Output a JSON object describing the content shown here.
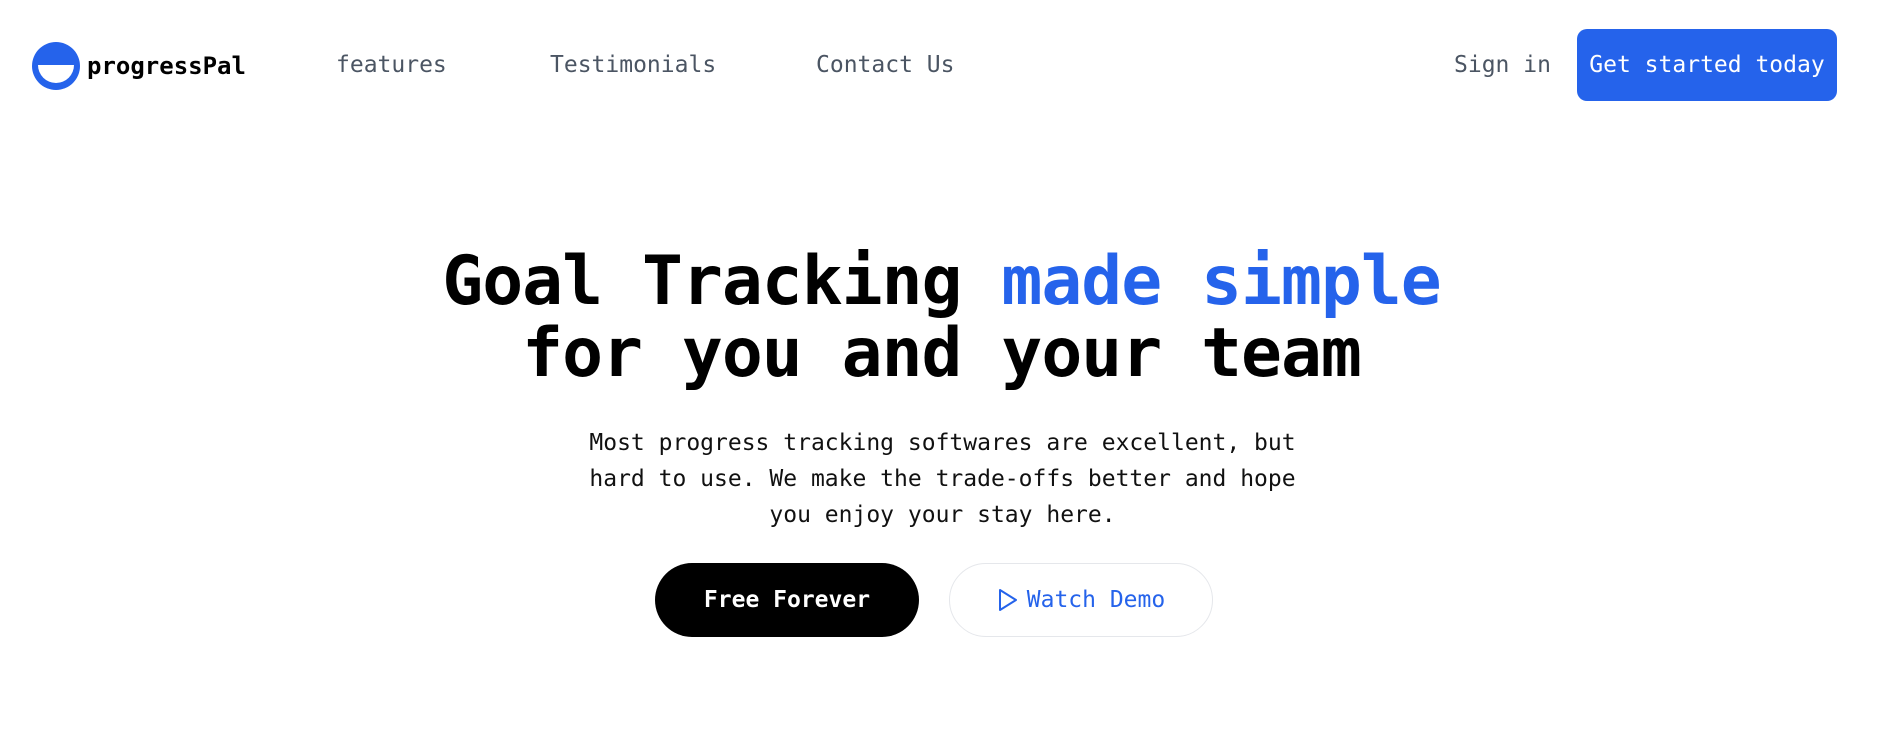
{
  "brand": {
    "name": "progressPal",
    "color": "#2563eb",
    "icon": "smile-circle-icon"
  },
  "nav": {
    "items": [
      {
        "label": "features"
      },
      {
        "label": "Testimonials"
      },
      {
        "label": "Contact Us"
      }
    ],
    "signin_label": "Sign in",
    "cta_label": "Get started today"
  },
  "hero": {
    "title_part1": "Goal Tracking ",
    "title_accent": "made simple",
    "title_part2": "for you and your team",
    "subtitle": "Most progress tracking softwares are excellent, but hard to use. We make the trade-offs better and hope you enjoy your stay here.",
    "primary_button": "Free Forever",
    "secondary_button": "Watch Demo",
    "secondary_icon": "play-icon"
  }
}
